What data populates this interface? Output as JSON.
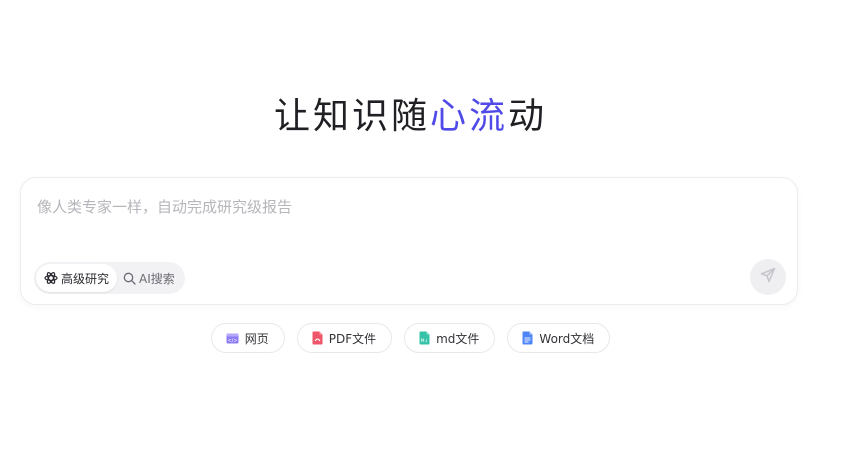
{
  "headline": {
    "part1": "让知识随",
    "accent": "心流",
    "part2": "动",
    "accent_color": "#4f4ae8"
  },
  "search": {
    "placeholder": "像人类专家一样，自动完成研究级报告",
    "value": ""
  },
  "modes": [
    {
      "label": "高级研究",
      "icon": "atom-icon",
      "active": true
    },
    {
      "label": "AI搜索",
      "icon": "search-icon",
      "active": false
    }
  ],
  "send_button": {
    "icon": "send-icon"
  },
  "chips": [
    {
      "label": "网页",
      "icon": "webpage-icon",
      "color": "#8b7cf6"
    },
    {
      "label": "PDF文件",
      "icon": "pdf-file-icon",
      "color": "#f0566a"
    },
    {
      "label": "md文件",
      "icon": "md-file-icon",
      "color": "#34c3a8"
    },
    {
      "label": "Word文档",
      "icon": "word-file-icon",
      "color": "#4f86f7"
    }
  ]
}
